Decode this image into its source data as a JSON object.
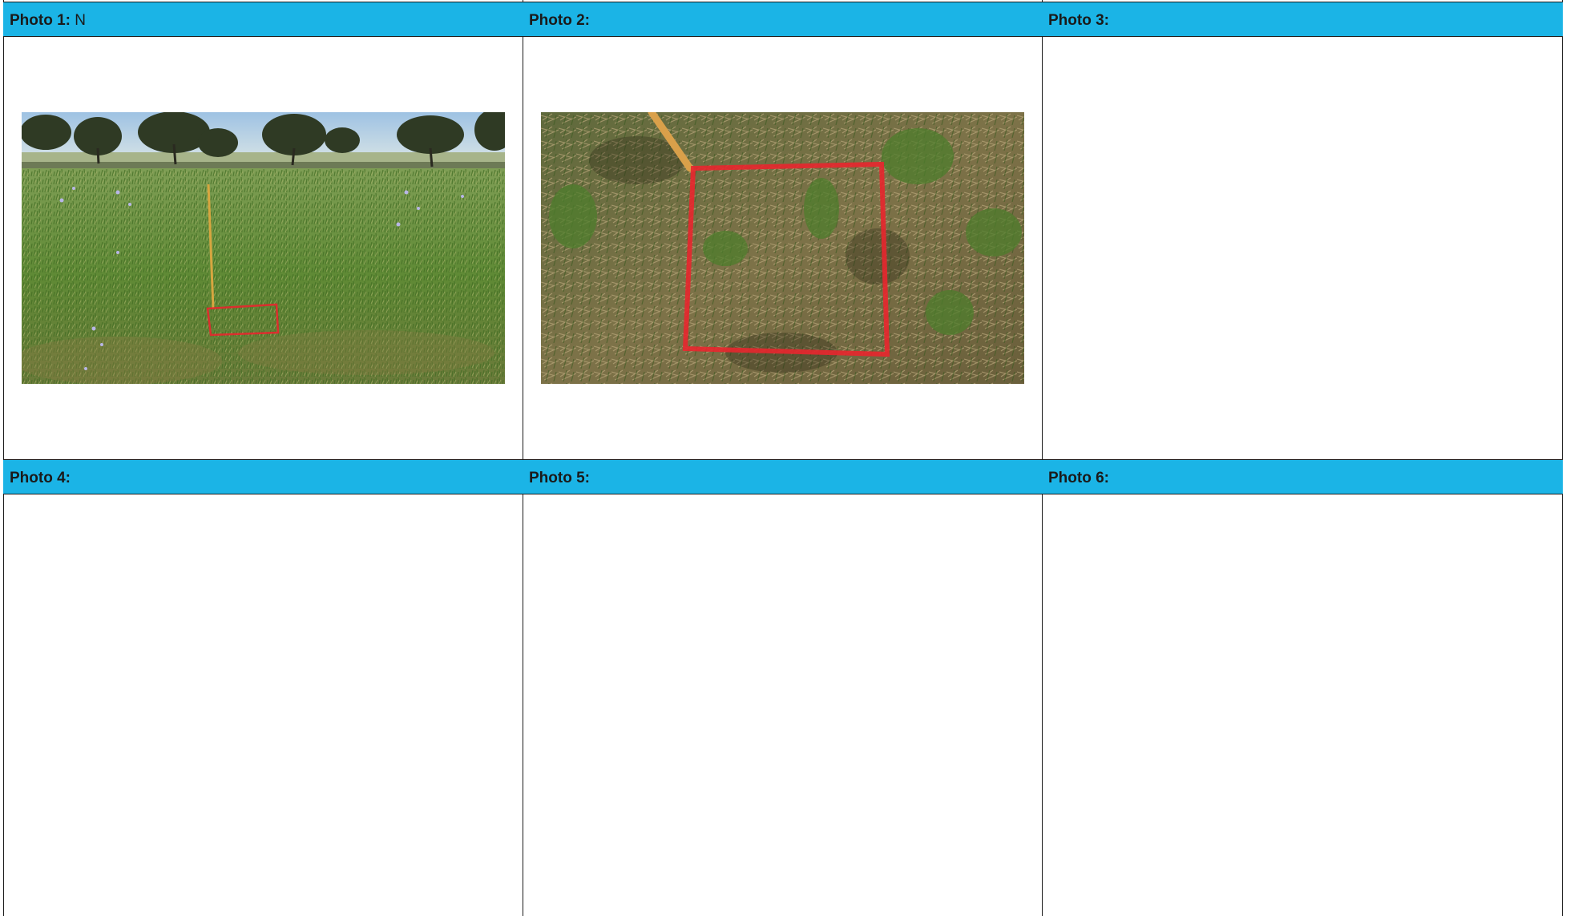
{
  "cells": [
    {
      "label": "Photo 1:",
      "note": "N"
    },
    {
      "label": "Photo 2:",
      "note": ""
    },
    {
      "label": "Photo 3:",
      "note": ""
    },
    {
      "label": "Photo 4:",
      "note": ""
    },
    {
      "label": "Photo 5:",
      "note": ""
    },
    {
      "label": "Photo 6:",
      "note": ""
    }
  ],
  "colors": {
    "header_background": "#1bb4e6",
    "grid_lines": "#1b1b1b",
    "quadrat_marker": "#e8262e"
  },
  "images": [
    {
      "cell": "Photo 1:",
      "content": "pasture-with-quadrat-photo"
    },
    {
      "cell": "Photo 2:",
      "content": "quadrat-closeup-photo"
    }
  ]
}
